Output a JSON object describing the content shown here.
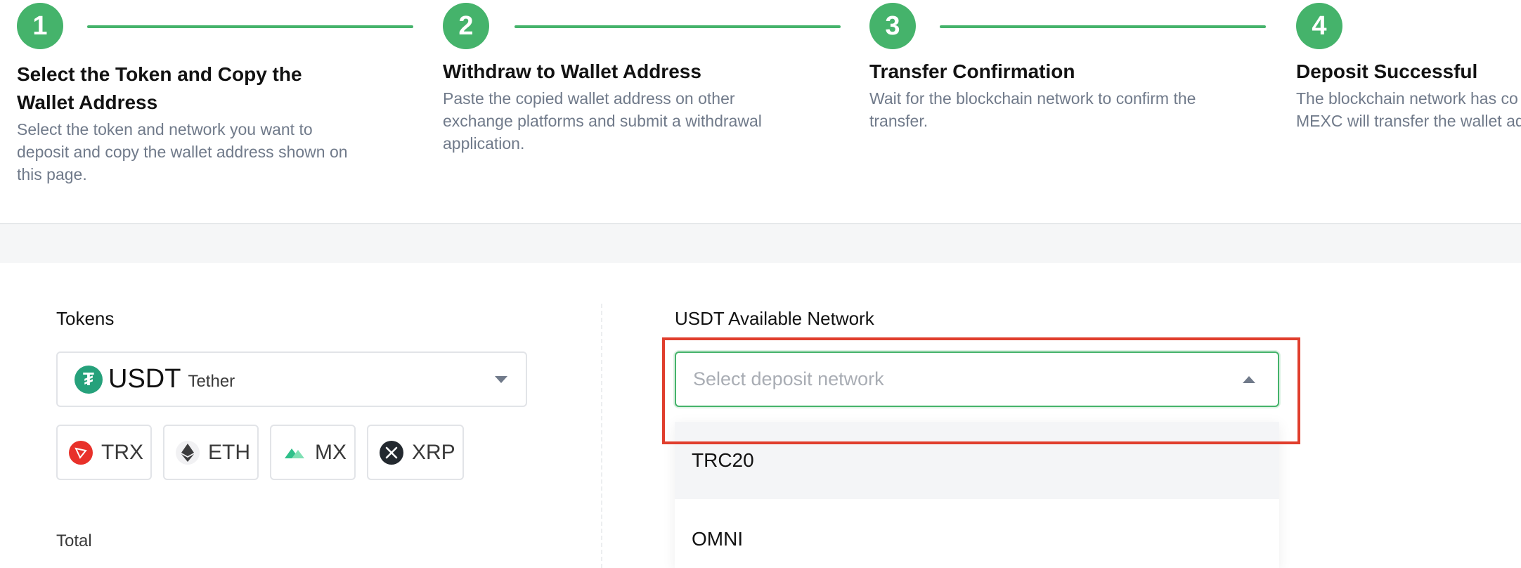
{
  "steps": [
    {
      "number": "1",
      "title": "Select the Token and Copy the Wallet Address",
      "desc": "Select the token and network you want to deposit and copy the wallet address shown on this page."
    },
    {
      "number": "2",
      "title": "Withdraw to Wallet Address",
      "desc": "Paste the copied wallet address on other exchange platforms and submit a withdrawal application."
    },
    {
      "number": "3",
      "title": "Transfer Confirmation",
      "desc": "Wait for the blockchain network to confirm the transfer."
    },
    {
      "number": "4",
      "title": "Deposit Successful",
      "desc": "The blockchain network has co transfer. MEXC will transfer the wallet address."
    }
  ],
  "tokens": {
    "label": "Tokens",
    "selected": {
      "symbol": "USDT",
      "name": "Tether",
      "icon": "tether-icon",
      "color": "#26a17b"
    },
    "quick": [
      {
        "label": "TRX",
        "icon": "tron-icon",
        "color": "#e8312a"
      },
      {
        "label": "ETH",
        "icon": "ethereum-icon",
        "color": "#3c3c3d"
      },
      {
        "label": "MX",
        "icon": "mx-icon",
        "color": "#2fc08a"
      },
      {
        "label": "XRP",
        "icon": "xrp-icon",
        "color": "#23292f"
      }
    ]
  },
  "total": {
    "label": "Total"
  },
  "network": {
    "label": "USDT Available Network",
    "placeholder": "Select deposit network",
    "options": [
      "TRC20",
      "OMNI"
    ]
  },
  "colors": {
    "accent": "#45b36b",
    "highlight": "#e03e2d"
  }
}
